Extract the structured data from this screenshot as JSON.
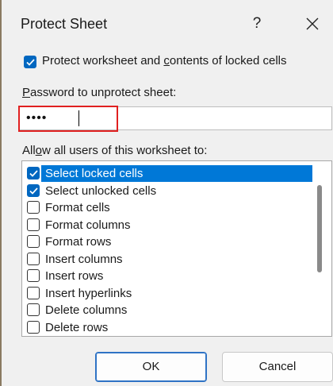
{
  "dialog": {
    "title": "Protect Sheet",
    "help_label": "?",
    "close_icon": "close-icon"
  },
  "protect": {
    "checked": true,
    "label_prefix": "Protect worksheet and ",
    "label_accel": "c",
    "label_suffix": "ontents of locked cells"
  },
  "password": {
    "label_accel": "P",
    "label_rest": "assword to unprotect sheet:",
    "value": "••••"
  },
  "permissions": {
    "label_prefix": "All",
    "label_accel": "o",
    "label_suffix": "w all users of this worksheet to:",
    "items": [
      {
        "label": "Select locked cells",
        "checked": true,
        "selected": true
      },
      {
        "label": "Select unlocked cells",
        "checked": true,
        "selected": false
      },
      {
        "label": "Format cells",
        "checked": false,
        "selected": false
      },
      {
        "label": "Format columns",
        "checked": false,
        "selected": false
      },
      {
        "label": "Format rows",
        "checked": false,
        "selected": false
      },
      {
        "label": "Insert columns",
        "checked": false,
        "selected": false
      },
      {
        "label": "Insert rows",
        "checked": false,
        "selected": false
      },
      {
        "label": "Insert hyperlinks",
        "checked": false,
        "selected": false
      },
      {
        "label": "Delete columns",
        "checked": false,
        "selected": false
      },
      {
        "label": "Delete rows",
        "checked": false,
        "selected": false
      }
    ]
  },
  "buttons": {
    "ok_label": "OK",
    "cancel_label": "Cancel"
  },
  "colors": {
    "accent": "#0067c0",
    "selection": "#0078d7",
    "highlight_box": "#e02020"
  }
}
